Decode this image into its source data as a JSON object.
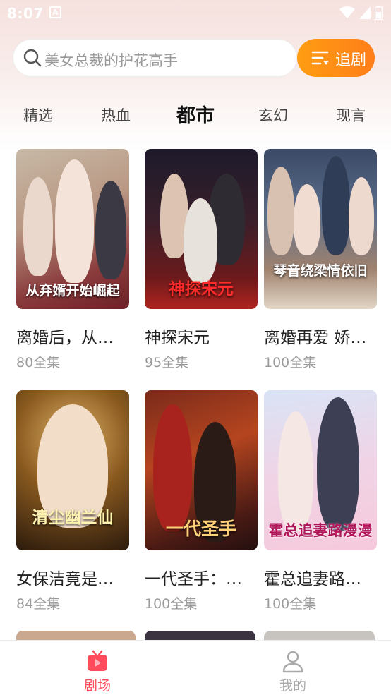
{
  "status_bar": {
    "time": "8:07",
    "notification_letter": "A"
  },
  "search": {
    "placeholder": "美女总裁的护花高手",
    "follow_label": "追剧"
  },
  "tabs": [
    {
      "label": "精选"
    },
    {
      "label": "热血"
    },
    {
      "label": "都市"
    },
    {
      "label": "玄幻"
    },
    {
      "label": "现言"
    }
  ],
  "active_tab": "都市",
  "dramas": [
    {
      "title": "离婚后，从弃婿开始崛起",
      "episodes": "80全集",
      "cover_text": "从弃婿开始崛起"
    },
    {
      "title": "神探宋元",
      "episodes": "95全集",
      "cover_text": "神探宋元"
    },
    {
      "title": "离婚再爱 娇妻别想逃",
      "episodes": "100全集",
      "cover_text": "琴音绕梁情依旧"
    },
    {
      "title": "女保洁竟是清尘幽兰仙",
      "episodes": "84全集",
      "cover_text": "清尘幽兰仙"
    },
    {
      "title": "一代圣手：神医",
      "episodes": "100全集",
      "cover_text": "一代圣手"
    },
    {
      "title": "霍总追妻路漫漫",
      "episodes": "100全集",
      "cover_text": "霍总追妻路漫漫"
    }
  ],
  "bottom_nav": [
    {
      "label": "剧场",
      "active": true
    },
    {
      "label": "我的",
      "active": false
    }
  ],
  "colors": {
    "accent_orange": "#ff8a14",
    "active_nav": "#ff4b5c",
    "inactive_nav": "#aaaaaa",
    "episode_text": "#9b9b9b"
  }
}
